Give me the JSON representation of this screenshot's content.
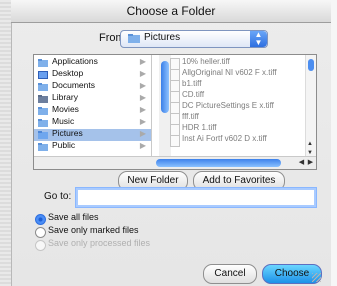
{
  "window": {
    "title": "Choose a Folder"
  },
  "from": {
    "label": "From:",
    "selected": "Pictures"
  },
  "sidebar": {
    "items": [
      {
        "label": "Applications",
        "icon": "applications-folder-icon"
      },
      {
        "label": "Desktop",
        "icon": "desktop-folder-icon"
      },
      {
        "label": "Documents",
        "icon": "documents-folder-icon"
      },
      {
        "label": "Library",
        "icon": "library-folder-icon"
      },
      {
        "label": "Movies",
        "icon": "movies-folder-icon"
      },
      {
        "label": "Music",
        "icon": "music-folder-icon"
      },
      {
        "label": "Pictures",
        "icon": "pictures-folder-icon",
        "selected": true
      },
      {
        "label": "Public",
        "icon": "public-folder-icon"
      }
    ]
  },
  "files": [
    {
      "name": "10% heller.tiff"
    },
    {
      "name": "AllgOriginal NI v602 F x.tiff"
    },
    {
      "name": "b1.tiff"
    },
    {
      "name": "CD.tiff"
    },
    {
      "name": "DC PictureSettings E x.tiff"
    },
    {
      "name": "fff.tiff"
    },
    {
      "name": "HDR 1.tiff"
    },
    {
      "name": "Inst Ai Fortf v602 D x.tiff"
    }
  ],
  "buttons": {
    "new_folder": "New Folder",
    "add_to_favorites": "Add to Favorites",
    "cancel": "Cancel",
    "choose": "Choose"
  },
  "goto": {
    "label": "Go to:",
    "value": ""
  },
  "save_options": [
    {
      "label": "Save all files",
      "selected": true,
      "disabled": false
    },
    {
      "label": "Save only marked files",
      "selected": false,
      "disabled": false
    },
    {
      "label": "Save only processed files",
      "selected": false,
      "disabled": true
    }
  ],
  "colors": {
    "accent": "#2e6fe0",
    "selection": "#a5c2ea",
    "choose_button": "#1d91e8"
  }
}
